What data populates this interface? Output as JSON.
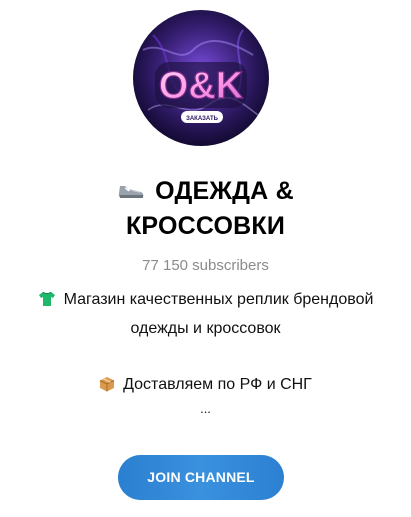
{
  "channel": {
    "title_line1": "ОДЕЖДА &",
    "title_line2": "КРОССОВКИ",
    "title_icon": "sneaker-icon",
    "subscribers": "77 150 subscribers",
    "avatar": {
      "logo_text": "O&K",
      "badge_text": "ЗАКАЗАТЬ"
    }
  },
  "description": {
    "line1": "Магазин качественных реплик брендовой",
    "line2": "одежды и кроссовок",
    "line1_icon": "tshirt-icon",
    "line3": "Доставляем по РФ и СНГ",
    "line3_icon": "package-icon",
    "ellipsis": "..."
  },
  "actions": {
    "join_label": "JOIN CHANNEL"
  },
  "colors": {
    "accent": "#2b7fd0",
    "muted": "#8a8a8a",
    "avatar_bg": "#2a1660"
  }
}
